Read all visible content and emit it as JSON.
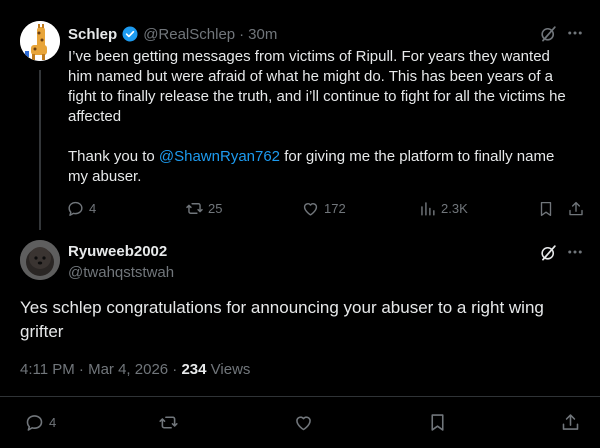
{
  "tweet1": {
    "name": "Schlep",
    "handle": "@RealSchlep",
    "separator": "·",
    "time": "30m",
    "text_line1": "I’ve been getting messages from victims of Ripull. For years they wanted him named but were afraid of what he might do. This has been years of a fight to finally release the truth, and i’ll continue to fight for all the victims he affected",
    "thanks_prefix": "Thank you to ",
    "mention": "@ShawnRyan762",
    "thanks_suffix": " for giving me the platform to finally name my abuser.",
    "replies": "4",
    "reposts": "25",
    "likes": "172",
    "views": "2.3K"
  },
  "tweet2": {
    "name": "Ryuweeb2002",
    "handle": "@twahqststwah",
    "text": "Yes schlep congratulations for announcing your abuser to a right wing grifter",
    "time": "4:11 PM · Mar 4, 2026 · ",
    "views_count": "234",
    "views_label": " Views",
    "replies": "4"
  },
  "colors": {
    "background": "#000000",
    "text": "#e7e9ea",
    "muted": "#71767b",
    "link": "#1d9bf0",
    "verified": "#1d9bf0"
  },
  "icons": [
    "grok-icon",
    "more-icon",
    "reply-icon",
    "repost-icon",
    "like-icon",
    "views-icon",
    "bookmark-icon",
    "share-icon",
    "verified-badge-icon"
  ]
}
